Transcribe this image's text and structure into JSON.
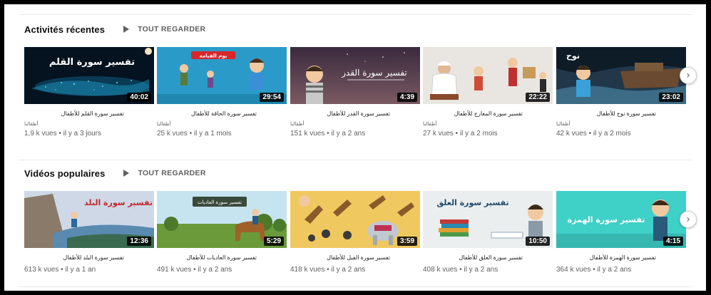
{
  "sections": [
    {
      "title": "Activités récentes",
      "play_all": "TOUT REGARDER",
      "videos": [
        {
          "title": "تفسير سورة القلم للأطفال",
          "channel": "أطفالنا",
          "meta": "1,9 k vues • il y a 3 jours",
          "duration": "40:02",
          "thumb_text": "تفسير سورة القلم"
        },
        {
          "title": "تفسير سورة الحاقة للأطفال",
          "channel": "أطفالنا",
          "meta": "25 k vues • il y a 1 mois",
          "duration": "29:54",
          "thumb_text": "يوم القيامة"
        },
        {
          "title": "تفسير سورة القدر للأطفال",
          "channel": "أطفالنا",
          "meta": "151 k vues • il y a 2 ans",
          "duration": "4:39",
          "thumb_text": "تفسير سورة القدر"
        },
        {
          "title": "تفسير سورة المعارج للأطفال",
          "channel": "أطفالنا",
          "meta": "27 k vues • il y a 2 mois",
          "duration": "22:22",
          "thumb_text": ""
        },
        {
          "title": "تفسير سورة نوح للأطفال",
          "channel": "أطفالنا",
          "meta": "42 k vues • il y a 2 mois",
          "duration": "23:02",
          "thumb_text": "نوح"
        }
      ]
    },
    {
      "title": "Vidéos populaires",
      "play_all": "TOUT REGARDER",
      "videos": [
        {
          "title": "تفسير سورة البلد للأطفال",
          "meta": "613 k vues • il y a 1 an",
          "duration": "12:36",
          "thumb_text": "تفسير سورة البلد"
        },
        {
          "title": "تفسير سورة العاديات للأطفال",
          "meta": "491 k vues • il y a 2 ans",
          "duration": "5:29",
          "thumb_text": "تفسير سورة العاديات"
        },
        {
          "title": "تفسير سورة الفيل للأطفال",
          "meta": "418 k vues • il y a 2 ans",
          "duration": "3:59",
          "thumb_text": ""
        },
        {
          "title": "تفسير سورة العلق للأطفال",
          "meta": "408 k vues • il y a 2 ans",
          "duration": "10:50",
          "thumb_text": "تفسير سورة العلق"
        },
        {
          "title": "تفسير سورة الهمزة للأطفال",
          "meta": "364 k vues • il y a 2 ans",
          "duration": "4:15",
          "thumb_text": "تفسير سورة الهمزة"
        }
      ]
    }
  ],
  "icons": {
    "play_all": "play-icon",
    "next": "chevron-right-icon"
  },
  "colors": {
    "duration_bg": "#000000",
    "meta_text": "#606060"
  }
}
